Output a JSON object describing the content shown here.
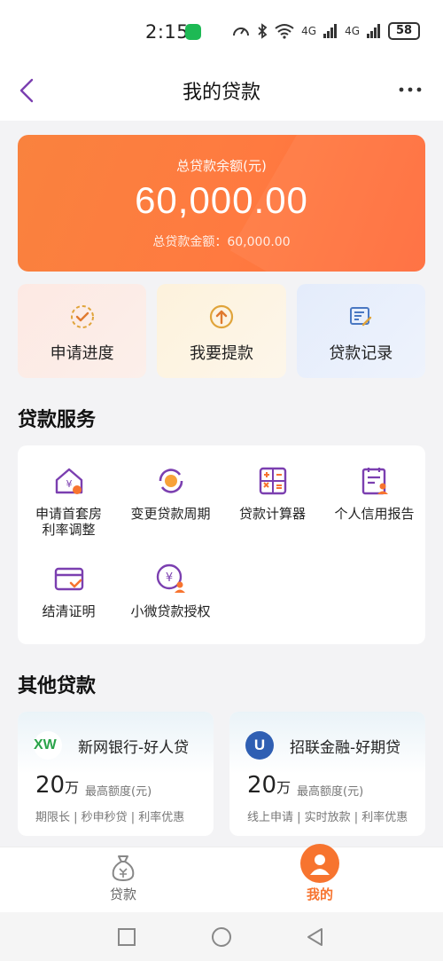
{
  "status": {
    "time": "2:15",
    "net1": "4G",
    "net2": "4G",
    "battery": "58"
  },
  "nav": {
    "title": "我的贷款"
  },
  "balance": {
    "label": "总贷款余额(元)",
    "amount": "60,000.00",
    "total": "总贷款金额：60,000.00"
  },
  "quick_actions": [
    {
      "label": "申请进度",
      "icon": "progress-check-icon"
    },
    {
      "label": "我要提款",
      "icon": "upload-arrow-icon"
    },
    {
      "label": "贷款记录",
      "icon": "record-edit-icon"
    }
  ],
  "services": {
    "title": "贷款服务",
    "items": [
      {
        "label_line1": "申请首套房",
        "label_line2": "利率调整",
        "icon": "house-yuan-icon"
      },
      {
        "label_line1": "变更贷款周期",
        "label_line2": "",
        "icon": "loan-cycle-icon"
      },
      {
        "label_line1": "贷款计算器",
        "label_line2": "",
        "icon": "calculator-icon"
      },
      {
        "label_line1": "个人信用报告",
        "label_line2": "",
        "icon": "credit-report-icon"
      },
      {
        "label_line1": "结清证明",
        "label_line2": "",
        "icon": "card-check-icon"
      },
      {
        "label_line1": "小微贷款授权",
        "label_line2": "",
        "icon": "yuan-person-icon"
      }
    ]
  },
  "other": {
    "title": "其他贷款",
    "loans": [
      {
        "logo": "XW",
        "name": "新网银行-好人贷",
        "amount": "20",
        "unit": "万",
        "limit": "最高额度(元)",
        "tags": "期限长 | 秒申秒贷 | 利率优惠"
      },
      {
        "logo": "U",
        "name": "招联金融-好期贷",
        "amount": "20",
        "unit": "万",
        "limit": "最高额度(元)",
        "tags": "线上申请 | 实时放款 | 利率优惠"
      }
    ]
  },
  "tabs": [
    {
      "label": "贷款",
      "active": false
    },
    {
      "label": "我的",
      "active": true
    }
  ],
  "colors": {
    "accent": "#f7742f",
    "purple": "#7b3fb0",
    "gold": "#e0a43a",
    "blue": "#4a78c2"
  }
}
